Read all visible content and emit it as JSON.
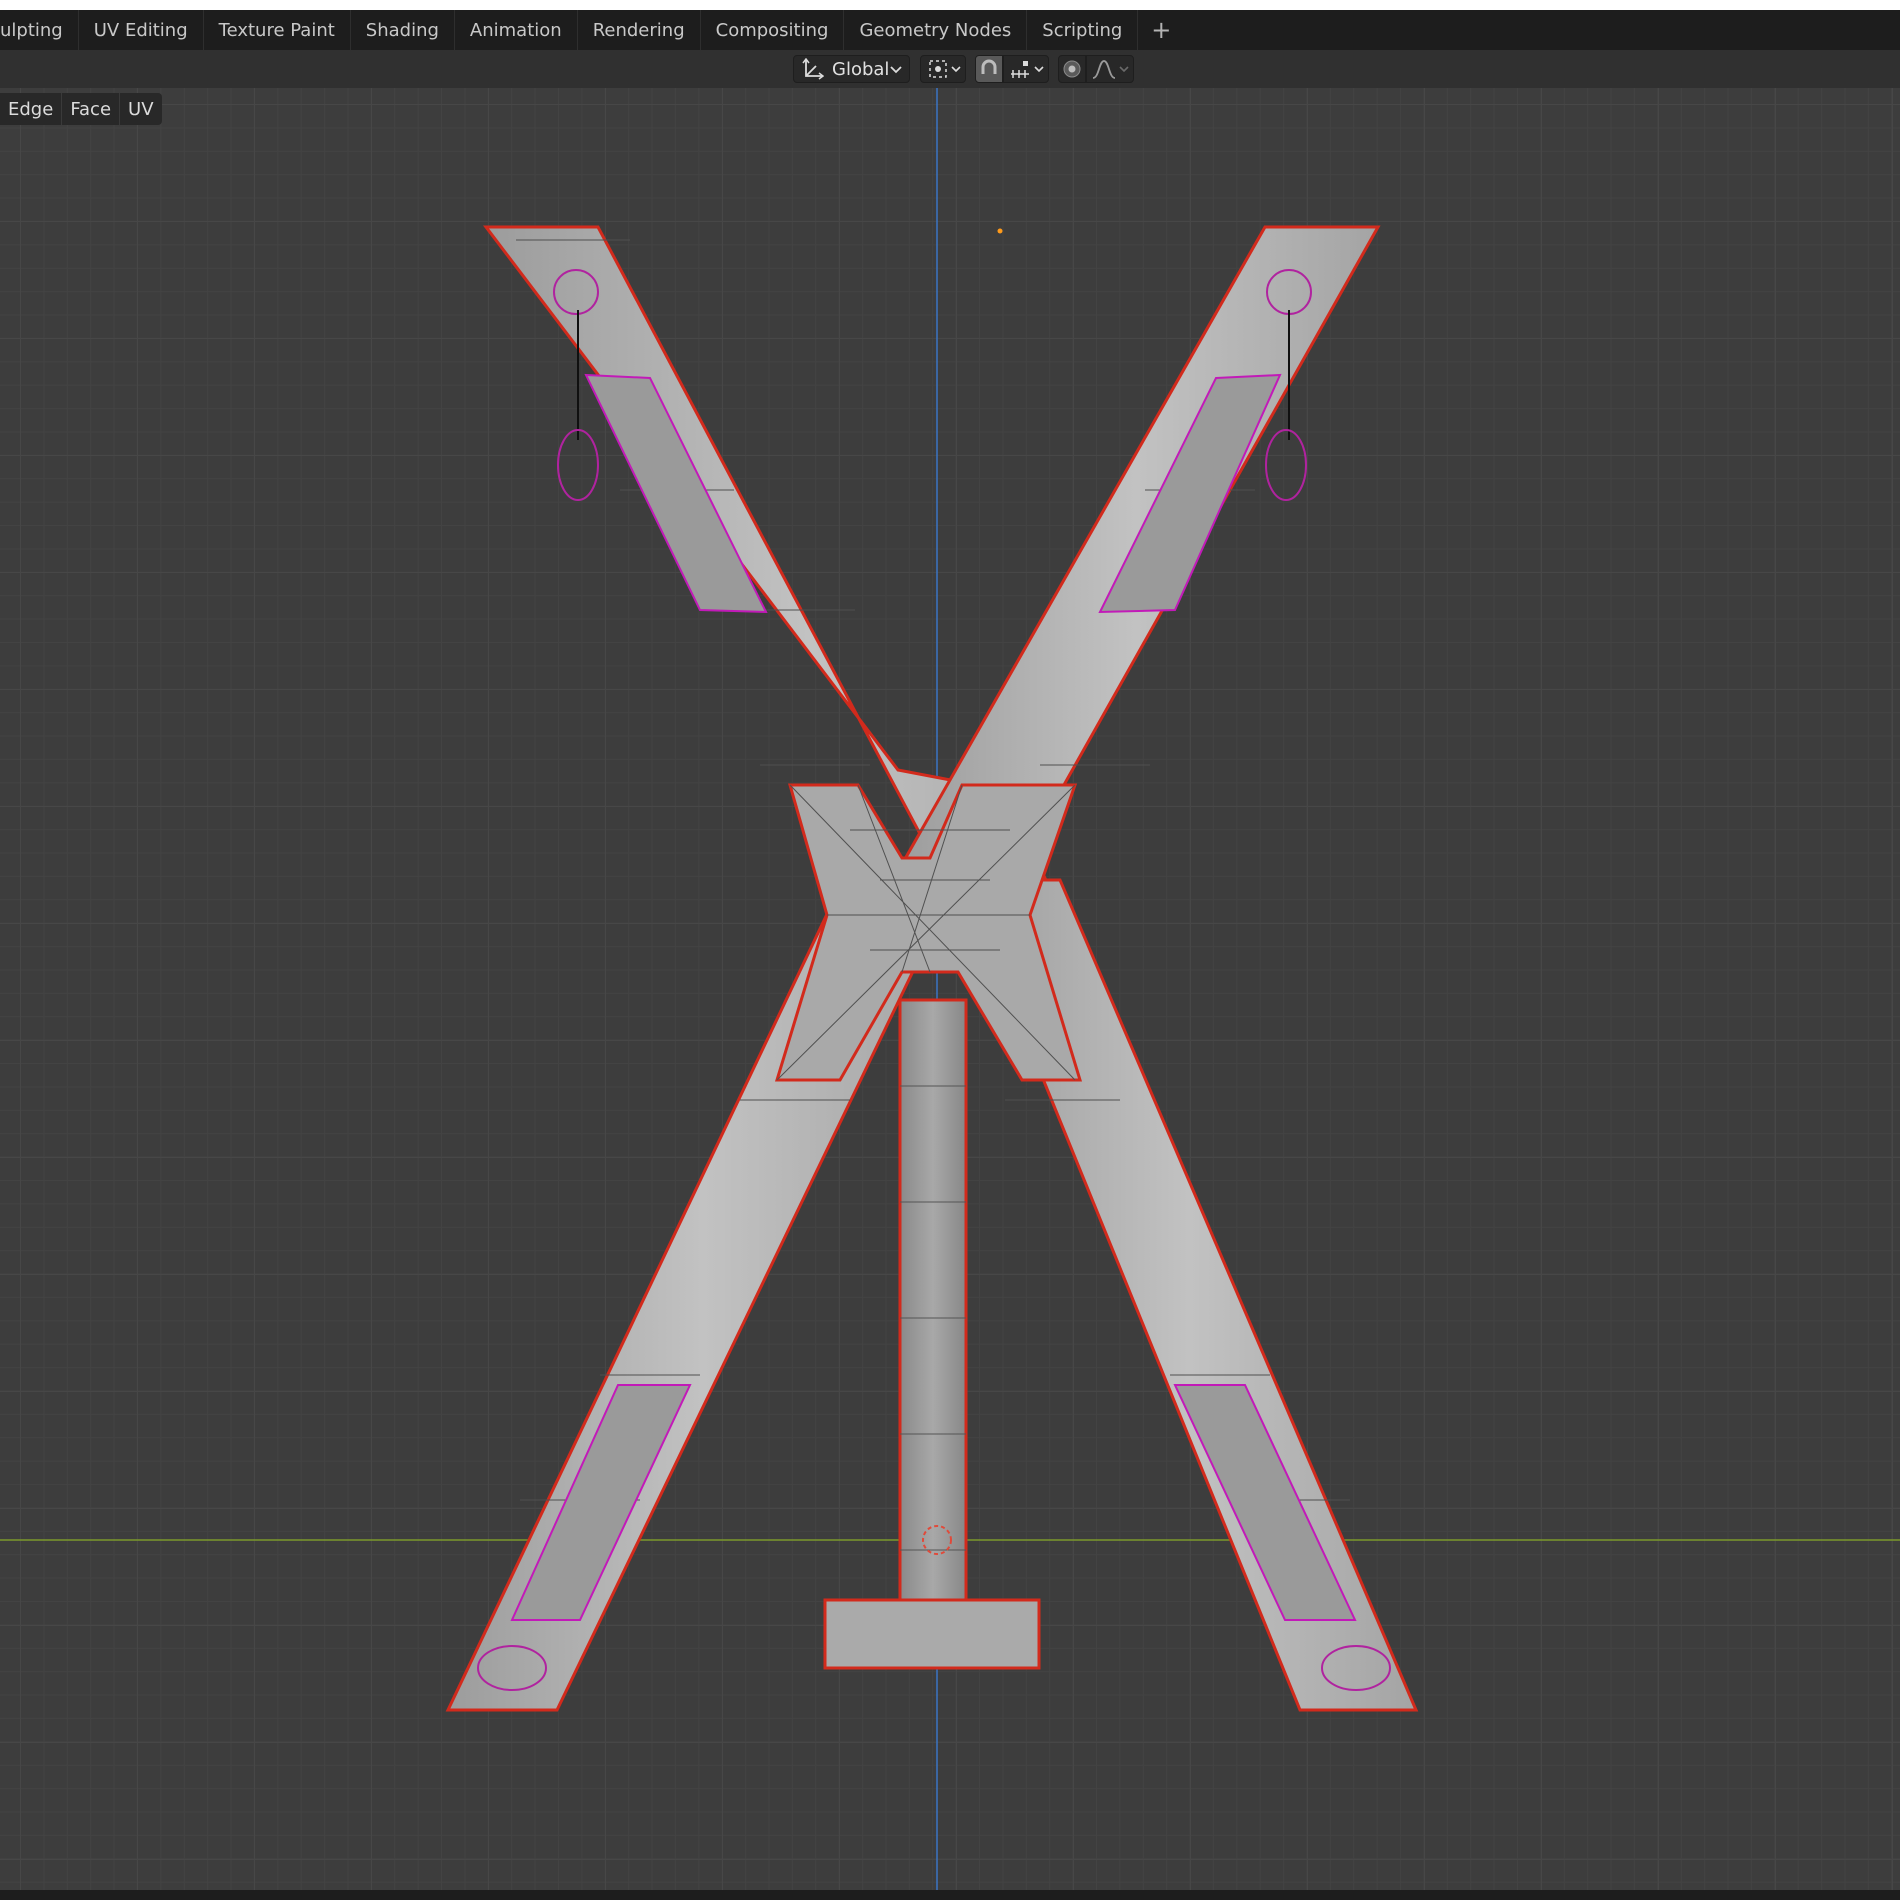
{
  "workspace_tabs": {
    "items": [
      {
        "label": "ulpting"
      },
      {
        "label": "UV Editing"
      },
      {
        "label": "Texture Paint"
      },
      {
        "label": "Shading"
      },
      {
        "label": "Animation"
      },
      {
        "label": "Rendering"
      },
      {
        "label": "Compositing"
      },
      {
        "label": "Geometry Nodes"
      },
      {
        "label": "Scripting"
      }
    ],
    "add_icon": "plus-icon"
  },
  "header": {
    "transform_orientation": "Global",
    "orientation_icon": "transform-axes-icon",
    "pivot_icon": "pivot-point-icon",
    "snap_icon": "magnet-snap-icon",
    "snap_target_icon": "snap-increment-icon",
    "proportional_icon": "proportional-edit-icon",
    "falloff_icon": "falloff-curve-icon"
  },
  "select_menu": {
    "items": [
      {
        "label": "Edge"
      },
      {
        "label": "Face"
      },
      {
        "label": "UV"
      }
    ]
  },
  "scene": {
    "object": "x-cross-frame-mesh",
    "mode": "edit-mode",
    "colors": {
      "mesh_fill": "#b6b6b6",
      "selected_outline": "#d22a1c",
      "seam_edges": "#c21ab8",
      "x_axis": "#7c9a2c",
      "z_axis": "#3b75c4",
      "grid": "#474747",
      "background": "#3d3d3d"
    }
  }
}
